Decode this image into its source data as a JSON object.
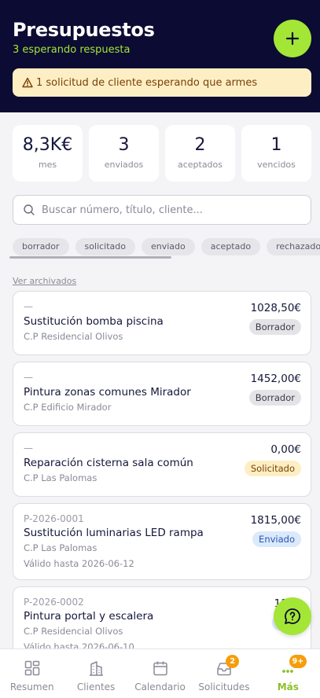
{
  "header": {
    "title": "Presupuestos",
    "subtitle": "3 esperando respuesta",
    "alert": "1 solicitud de cliente esperando que armes"
  },
  "stats": [
    {
      "value": "8,3K€",
      "label": "mes"
    },
    {
      "value": "3",
      "label": "enviados"
    },
    {
      "value": "2",
      "label": "aceptados"
    },
    {
      "value": "1",
      "label": "vencidos"
    }
  ],
  "search": {
    "placeholder": "Buscar número, título, cliente..."
  },
  "filters": [
    "borrador",
    "solicitado",
    "enviado",
    "aceptado",
    "rechazado"
  ],
  "archived_link": "Ver archivados",
  "quotes": [
    {
      "number": "—",
      "title": "Sustitución bomba piscina",
      "client": "C.P Residencial Olivos",
      "valid": "",
      "amount": "1028,50€",
      "status": "Borrador"
    },
    {
      "number": "—",
      "title": "Pintura zonas comunes Mirador",
      "client": "C.P Edificio Mirador",
      "valid": "",
      "amount": "1452,00€",
      "status": "Borrador"
    },
    {
      "number": "—",
      "title": "Reparación cisterna sala común",
      "client": "C.P Las Palomas",
      "valid": "",
      "amount": "0,00€",
      "status": "Solicitado"
    },
    {
      "number": "P-2026-0001",
      "title": "Sustitución luminarias LED rampa",
      "client": "C.P Las Palomas",
      "valid": "Válido hasta 2026-06-12",
      "amount": "1815,00€",
      "status": "Enviado"
    },
    {
      "number": "P-2026-0002",
      "title": "Pintura portal y escalera",
      "client": "C.P Residencial Olivos",
      "valid": "Válido hasta 2026-06-10",
      "amount": "1149",
      "status": "Env"
    }
  ],
  "tabs": [
    {
      "label": "Resumen",
      "icon": "dashboard-icon"
    },
    {
      "label": "Clientes",
      "icon": "buildings-icon"
    },
    {
      "label": "Calendario",
      "icon": "calendar-icon"
    },
    {
      "label": "Solicitudes",
      "icon": "inbox-icon",
      "badge": "2"
    },
    {
      "label": "Más",
      "icon": "more-icon",
      "badge": "9+"
    }
  ],
  "colors": {
    "header_bg": "#0b0b33",
    "accent": "#a3e635",
    "alert_bg": "#fdefc3",
    "badge_orange": "#f59e0b"
  }
}
